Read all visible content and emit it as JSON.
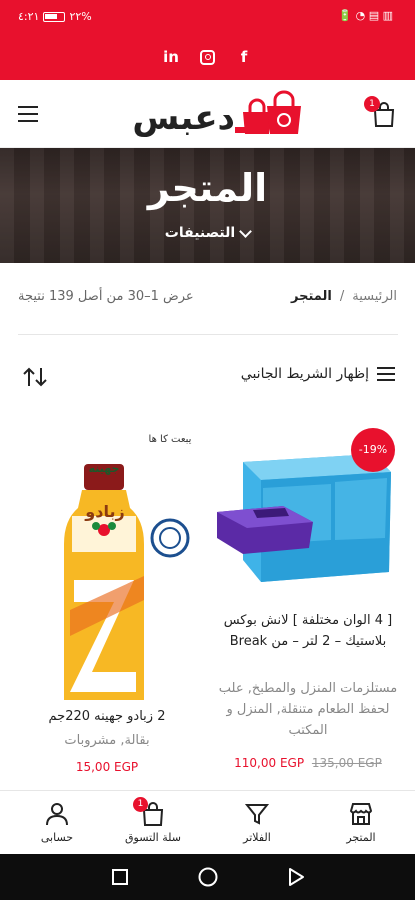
{
  "status_bar": {
    "time": "٤:٢١",
    "battery_percent": "٢٢%",
    "indicators": "🔋 ◔ ▤ ▥"
  },
  "social": {
    "icons": [
      "linkedin-icon",
      "instagram-icon",
      "facebook-icon"
    ]
  },
  "header": {
    "logo_text": "دعبس",
    "cart_count": "1"
  },
  "hero": {
    "title": "المتجر",
    "categories_label": "التصنيفات"
  },
  "breadcrumb": {
    "home": "الرئيسية",
    "separator": "/",
    "current": "المتجر"
  },
  "result_count": "عرض 1–30 من أصل 139 نتيجة",
  "filter": {
    "sidebar_toggle": "إظهار الشريط الجانبي"
  },
  "products": [
    {
      "sale_badge": "-19%",
      "title": "[ 4 الوان مختلفة ] لانش بوكس بلاستيك – 2 لتر – من Break",
      "categories": "مستلزمات المنزل والمطبخ, علب لحفظ الطعام متنقلة, المنزل و المكتب",
      "price_now": "110,00 EGP",
      "price_old": "135,00 EGP"
    },
    {
      "title": "2 زبادو جهينه 220جم",
      "categories": "بقالة, مشروبات",
      "price_now": "15,00 EGP",
      "image_text": "زبادو",
      "brand_text": "جهينه",
      "seal_text": "يبعت كا ها"
    }
  ],
  "bottom_nav": {
    "store": "المتجر",
    "filters": "الفلاتر",
    "cart": "سلة التسوق",
    "cart_count": "1",
    "account": "حسابى"
  },
  "colors": {
    "brand_red": "#e8112d"
  }
}
